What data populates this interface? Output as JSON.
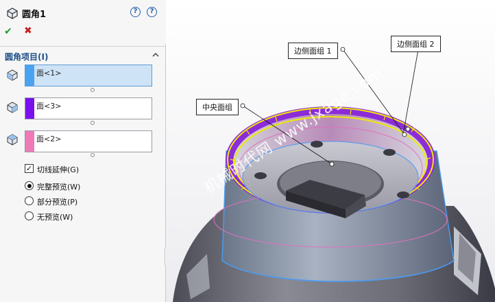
{
  "feature": {
    "title": "圆角1",
    "help_glyph": "?",
    "help_glyph_2": "?",
    "ok_glyph": "✔",
    "cancel_glyph": "✖"
  },
  "section": {
    "title": "圆角项目(I)",
    "faces": [
      {
        "label": "面<1>",
        "color": "#4aa3f0",
        "active": true
      },
      {
        "label": "面<3>",
        "color": "#7a10f0",
        "active": false
      },
      {
        "label": "面<2>",
        "color": "#f07ab8",
        "active": false
      }
    ],
    "tangent_propagation": {
      "label": "切线延伸(G)",
      "checked": true,
      "glyph": "✓"
    },
    "preview_options": [
      {
        "label": "完整预览(W)",
        "selected": true
      },
      {
        "label": "部分预览(P)",
        "selected": false
      },
      {
        "label": "无预览(W)",
        "selected": false
      }
    ]
  },
  "viewport": {
    "callouts": {
      "side_group_1": "边侧面组 1",
      "side_group_2": "边侧面组 2",
      "center_group": "中央面组"
    },
    "watermark": "机械时代网 www.jxage.com",
    "colors": {
      "model_body": "#7a7a82",
      "rim_purple": "#8c2cd8",
      "edge_yellow": "#f1e60a",
      "preview_blue": "#4a9cf3",
      "preview_pink": "#e070c0"
    }
  }
}
